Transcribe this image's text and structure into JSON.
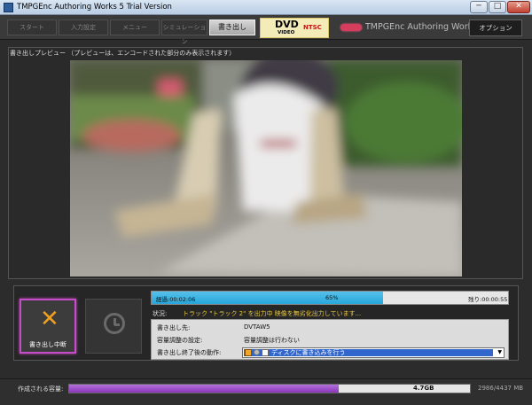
{
  "window": {
    "title": "TMPGEnc Authoring Works 5 Trial Version",
    "minimize": "─",
    "maximize": "□",
    "close": "✕"
  },
  "steps": [
    {
      "label": "スタート",
      "active": false
    },
    {
      "label": "入力設定",
      "active": false
    },
    {
      "label": "メニュー",
      "active": false
    },
    {
      "label": "シミュレーション",
      "active": false
    },
    {
      "label": "書き出し",
      "active": true
    }
  ],
  "badge": {
    "dvd": "DVD",
    "video": "VIDEO",
    "ntsc": "NTSC"
  },
  "brand": "TMPGEnc Authoring Works 5",
  "option_label": "オプション",
  "preview_header": "書き出しプレビュー （プレビューは、エンコードされた部分のみ表示されます）",
  "controls": {
    "stop_label": "書き出し中断",
    "stop_icon": "✕"
  },
  "progress": {
    "elapsed": "経過:00:02:06",
    "percent_text": "65%",
    "remaining": "残り:00:00:55",
    "fraction": 0.65
  },
  "status": {
    "label": "状況:",
    "text": "トラック \"トラック 2\" を出力中  映像を無劣化出力しています..."
  },
  "info": {
    "dest_label": "書き出し先:",
    "dest_value": "DVTAW5",
    "capacity_label": "容量調整の設定:",
    "capacity_value": "容量調整は行わない",
    "after_label": "書き出し終了後の動作:",
    "after_value": "ディスクに書き込みを行う",
    "after_arrow": "▼"
  },
  "capacity": {
    "label": "作成される容量:",
    "gb": "4.7GB",
    "mb": "2986/4437 MB",
    "fraction": 0.673
  },
  "colors": {
    "accent_progress": "#27a6dc",
    "capacity_fill": "#8a35b9",
    "stop_border": "#c54ec6",
    "status_text": "#e7c53e"
  }
}
